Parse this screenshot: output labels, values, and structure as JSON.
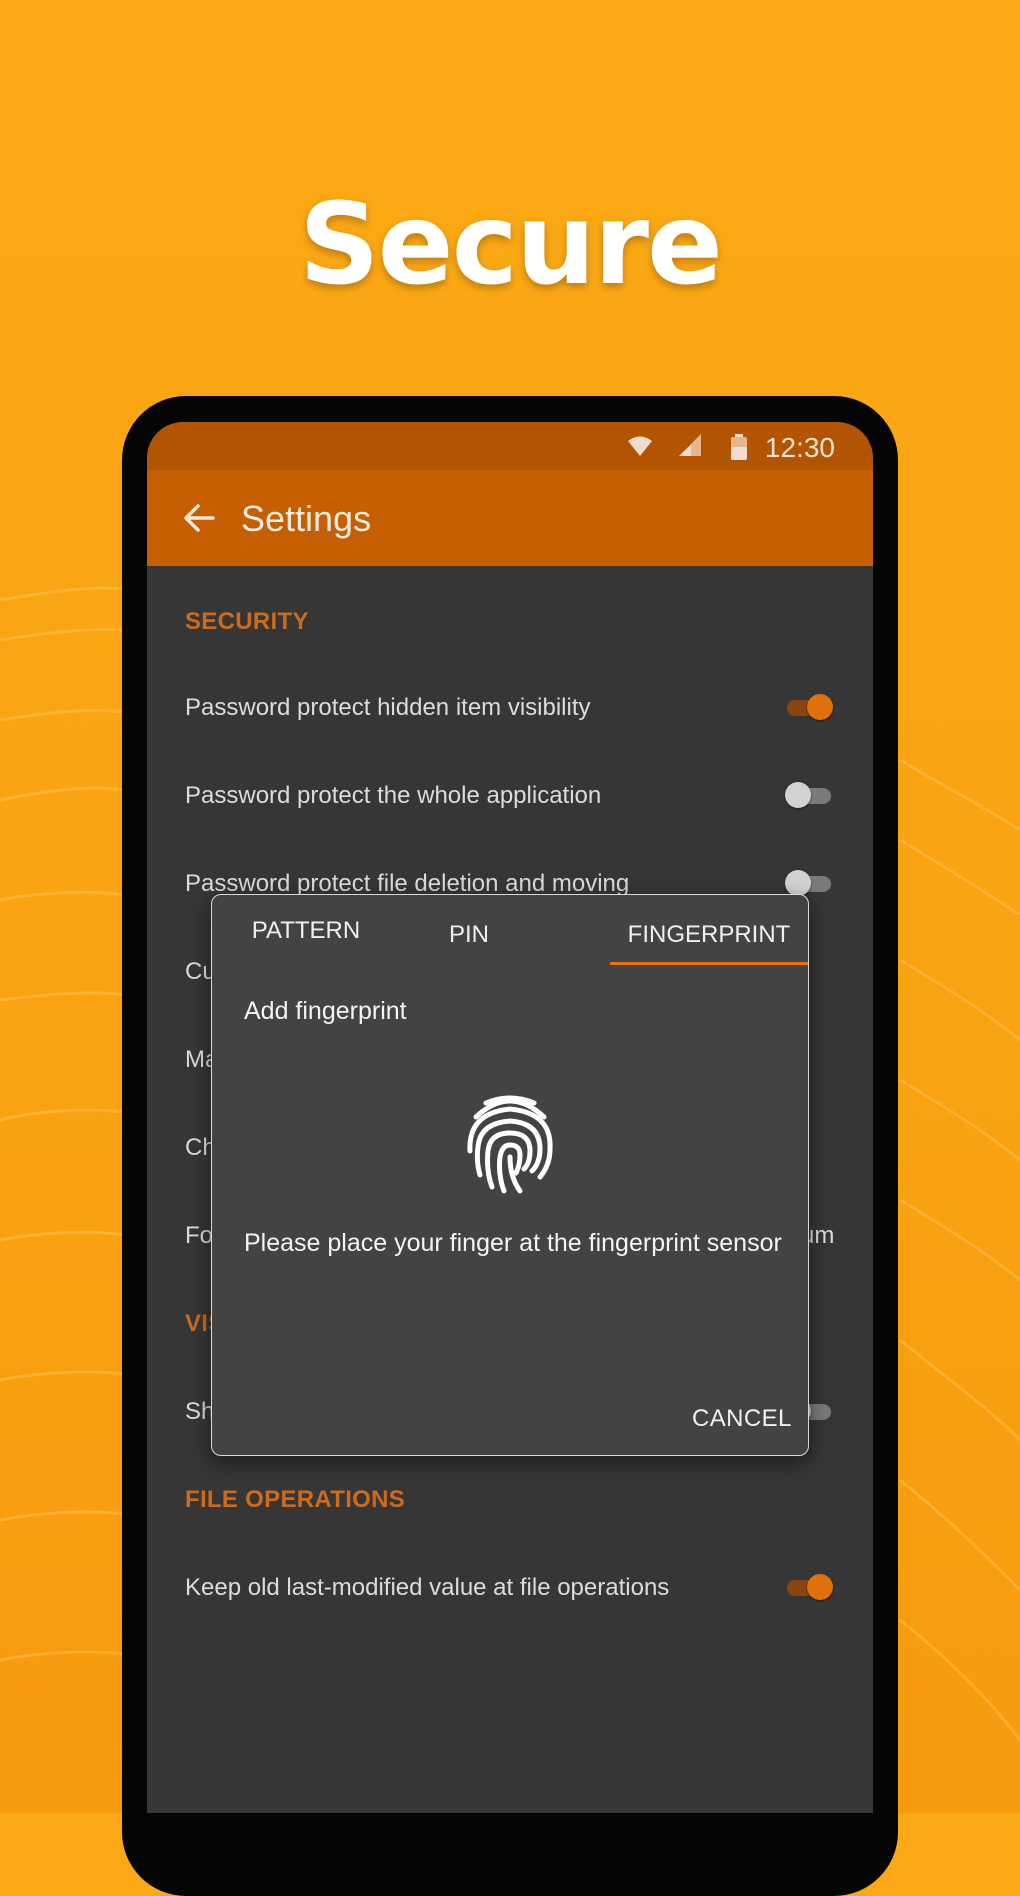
{
  "headline": "Secure",
  "status_bar": {
    "time": "12:30"
  },
  "app_bar": {
    "title": "Settings"
  },
  "sections": {
    "security": {
      "header": "SECURITY",
      "rows": [
        {
          "label": "Password protect hidden item visibility",
          "toggle_on": true
        },
        {
          "label": "Password protect the whole application",
          "toggle_on": false
        },
        {
          "label": "Password protect file deletion and moving",
          "toggle_on": false
        },
        {
          "label": "Cu"
        },
        {
          "label": "Ma"
        },
        {
          "label": "Ch"
        },
        {
          "label": "Fo",
          "trailing": "um"
        }
      ]
    },
    "visibility": {
      "header": "VIS",
      "rows": [
        {
          "label": "Sh",
          "toggle_on": false
        }
      ]
    },
    "file_operations": {
      "header": "FILE OPERATIONS",
      "rows": [
        {
          "label": "Keep old last-modified value at file operations",
          "toggle_on": true
        }
      ]
    }
  },
  "dialog": {
    "tabs": [
      {
        "label": "PATTERN",
        "selected": false
      },
      {
        "label": "PIN",
        "selected": false
      },
      {
        "label": "FINGERPRINT",
        "selected": true
      }
    ],
    "title": "Add fingerprint",
    "icon": "fingerprint-icon",
    "message": "Please place your finger at the fingerprint sensor",
    "cancel_label": "CANCEL"
  },
  "colors": {
    "background": "#fca916",
    "app_bar": "#c55f02",
    "status_bar": "#b25402",
    "accent": "#e3730f",
    "screen_bg": "#363636",
    "dialog_bg": "#434343"
  }
}
